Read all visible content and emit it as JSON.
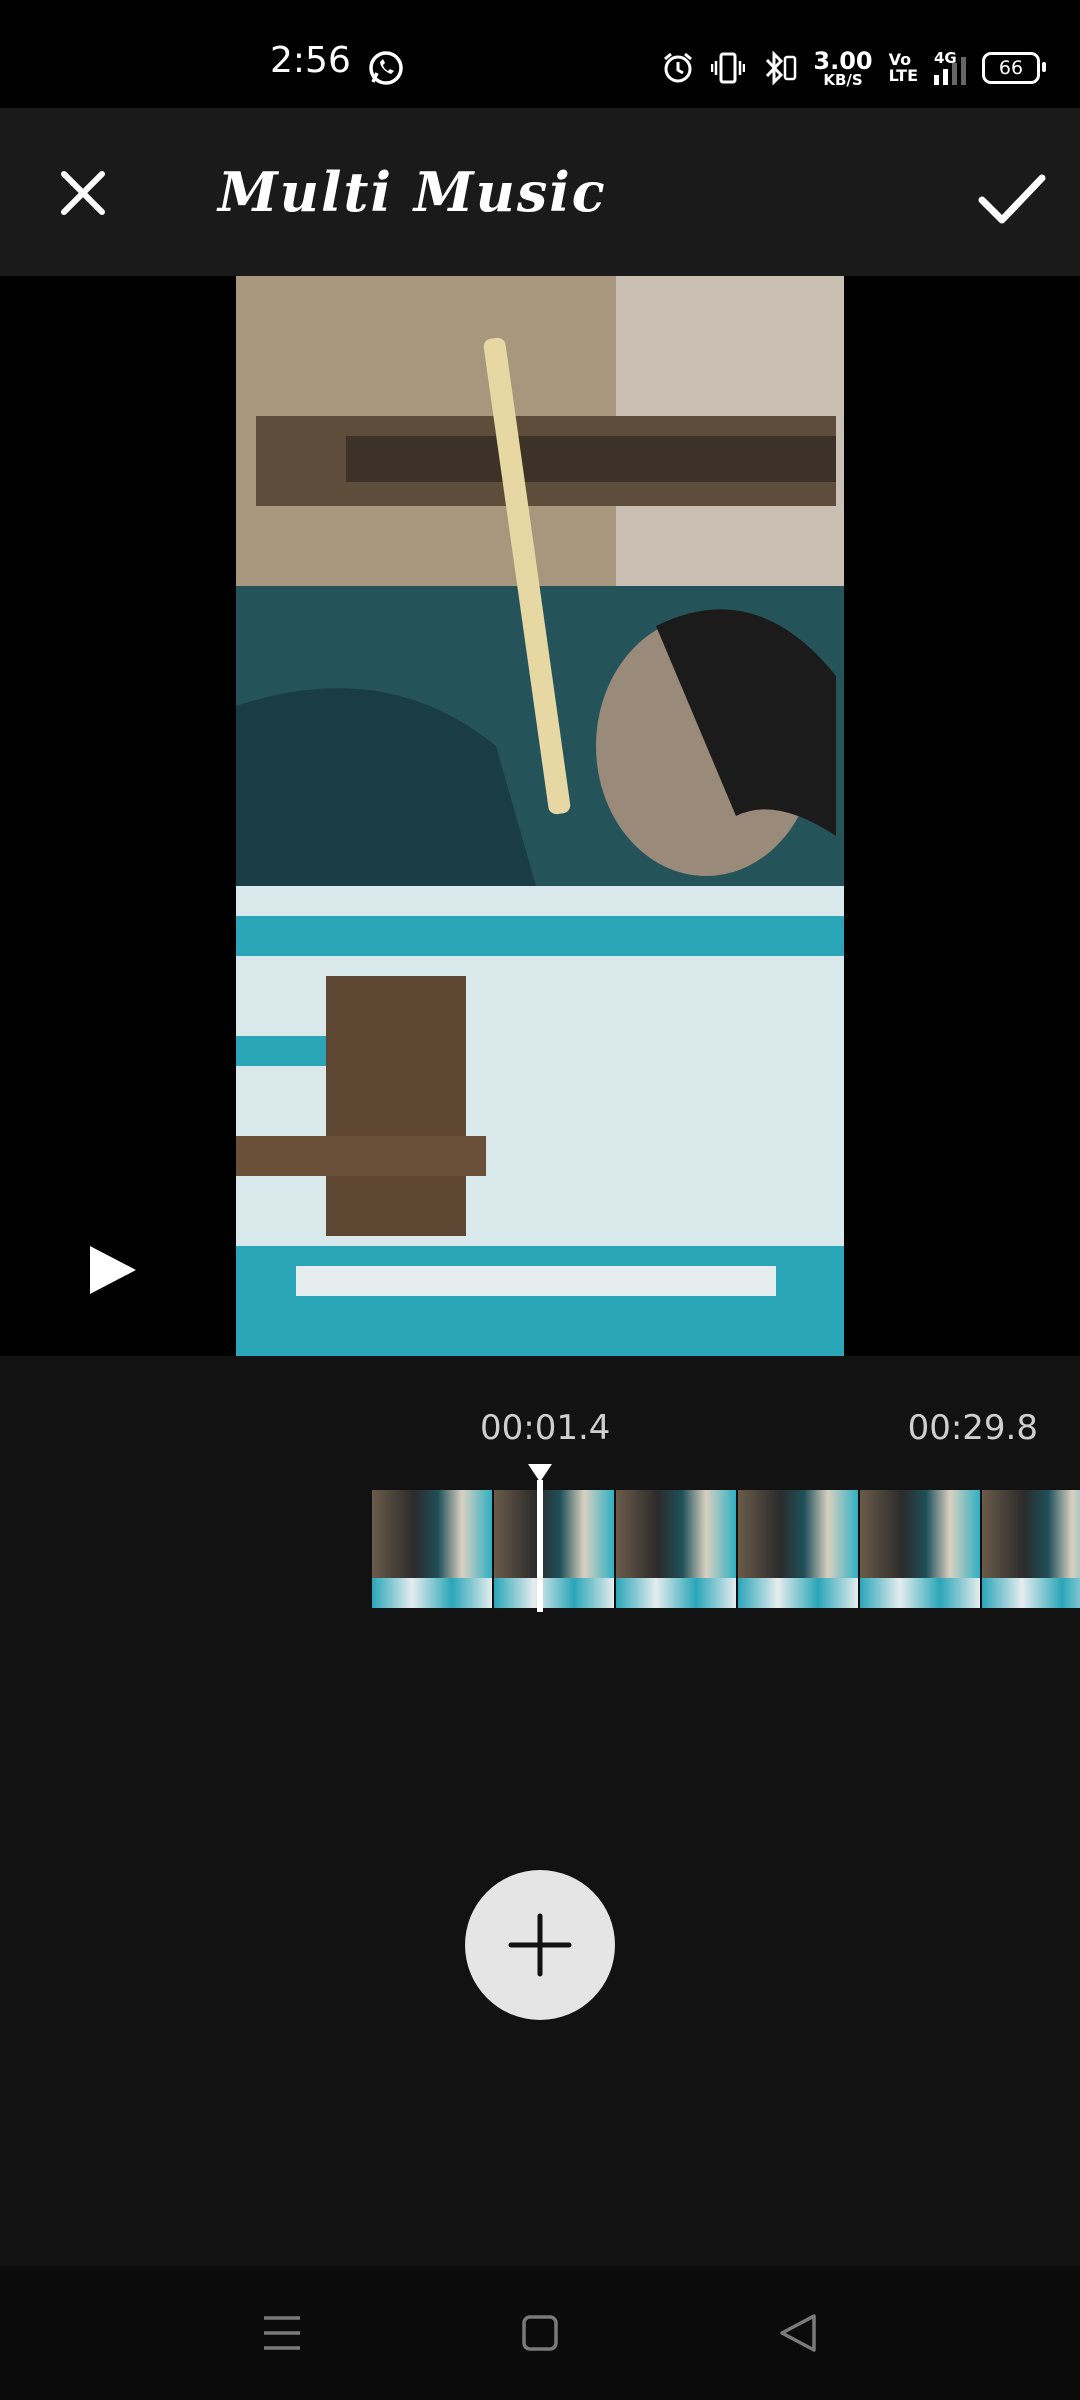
{
  "status_bar": {
    "time": "2:56",
    "net_speed_value": "3.00",
    "net_speed_unit": "KB/S",
    "volte_top": "Vo",
    "volte_bottom": "LTE",
    "network": "4G",
    "battery": "66",
    "icons": [
      "whatsapp-icon",
      "alarm-icon",
      "vibrate-icon",
      "bluetooth-icon",
      "signal-icon",
      "battery-icon"
    ]
  },
  "toolbar": {
    "title": "Multi Music",
    "close_icon": "close-icon",
    "confirm_icon": "check-icon"
  },
  "player": {
    "play_icon": "play-icon"
  },
  "timeline": {
    "current_time": "00:01.4",
    "total_time": "00:29.8",
    "thumbnail_count": 6
  },
  "actions": {
    "add_icon": "plus-icon"
  },
  "nav_bar": {
    "icons": [
      "menu-icon",
      "home-icon",
      "back-icon"
    ]
  },
  "colors": {
    "background": "#121212",
    "toolbar": "#1a1a1a",
    "add_button": "#e5e5e5"
  }
}
